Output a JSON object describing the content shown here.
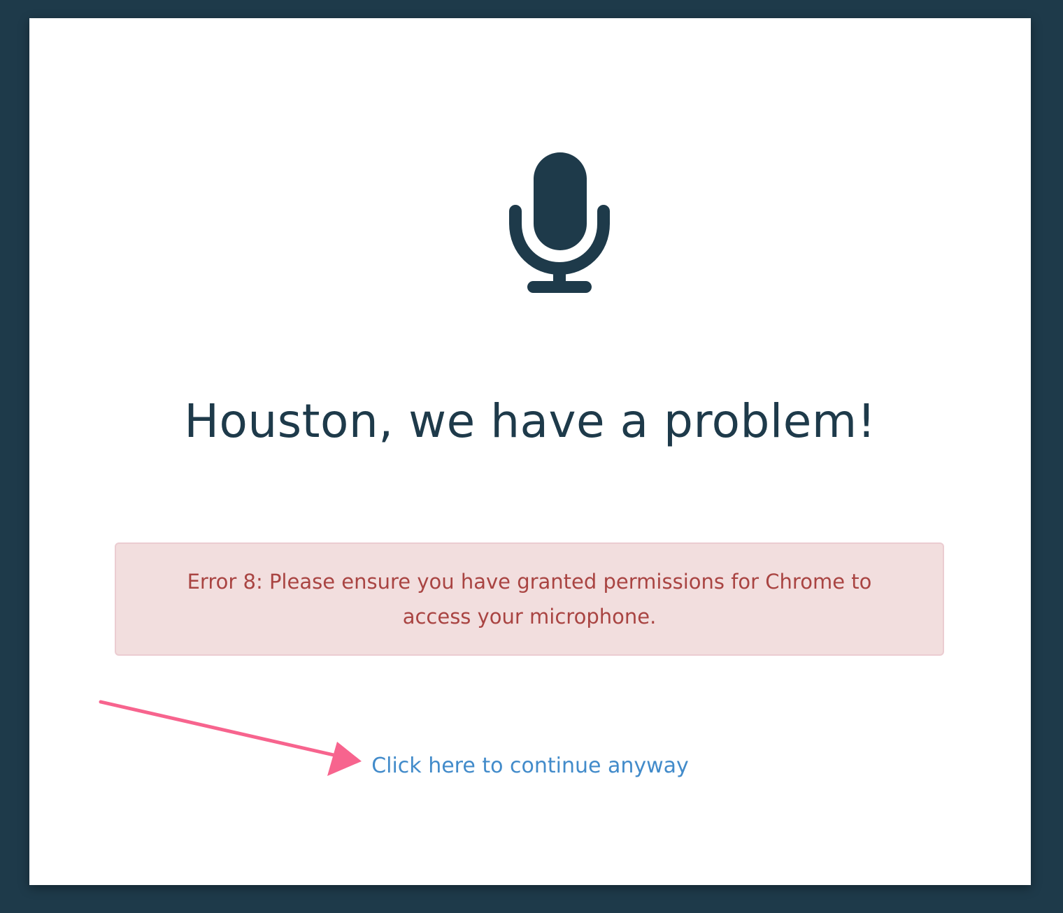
{
  "page": {
    "title": "Houston, we have a problem!",
    "error_message": "Error 8: Please ensure you have granted permissions for Chrome to access your microphone.",
    "continue_link": "Click here to continue anyway"
  },
  "icons": {
    "main": "microphone-icon",
    "annotation": "arrow-annotation"
  },
  "colors": {
    "background": "#1e3a4a",
    "card": "#ffffff",
    "icon": "#1e3a4a",
    "title": "#1e3a4a",
    "alert_bg": "#f2dede",
    "alert_border": "#ebccd1",
    "alert_text": "#a94442",
    "link": "#428bca",
    "annotation_arrow": "#f7648e"
  }
}
